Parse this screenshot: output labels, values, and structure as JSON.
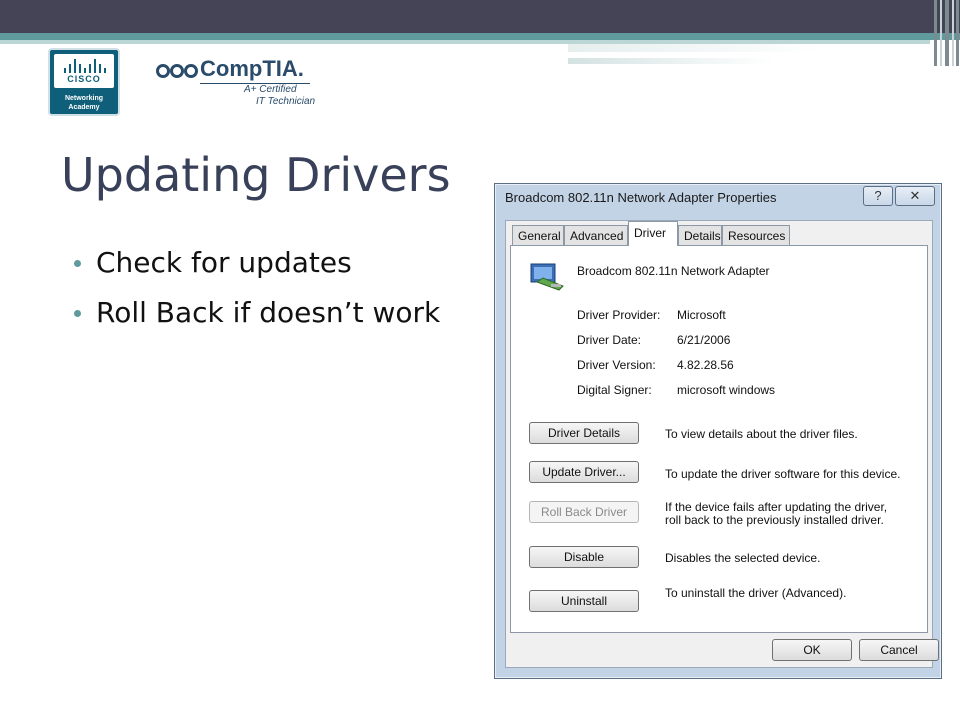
{
  "logos": {
    "cisco_word": "CISCO",
    "cisco_sub1": "Networking",
    "cisco_sub2": "Academy",
    "comptia_name": "CompTIA.",
    "comptia_cert": "A+ Certified",
    "comptia_tech": "IT Technician"
  },
  "slide": {
    "title": "Updating Drivers",
    "bullets": [
      "Check for updates",
      "Roll Back if doesn’t work"
    ]
  },
  "dialog": {
    "title": "Broadcom 802.11n Network Adapter Properties",
    "help_label": "?",
    "close_label": "✕",
    "tabs": [
      "General",
      "Advanced",
      "Driver",
      "Details",
      "Resources"
    ],
    "active_tab": "Driver",
    "device_name": "Broadcom 802.11n Network Adapter",
    "properties": [
      {
        "label": "Driver Provider:",
        "value": "Microsoft"
      },
      {
        "label": "Driver Date:",
        "value": "6/21/2006"
      },
      {
        "label": "Driver Version:",
        "value": "4.82.28.56"
      },
      {
        "label": "Digital Signer:",
        "value": "microsoft windows"
      }
    ],
    "actions": [
      {
        "label": "Driver Details",
        "desc": "To view details about the driver files.",
        "enabled": true
      },
      {
        "label": "Update Driver...",
        "desc": "To update the driver software for this device.",
        "enabled": true
      },
      {
        "label": "Roll Back Driver",
        "desc": "If the device fails after updating the driver, roll back to the previously installed driver.",
        "enabled": false
      },
      {
        "label": "Disable",
        "desc": "Disables the selected device.",
        "enabled": true
      },
      {
        "label": "Uninstall",
        "desc": "To uninstall the driver (Advanced).",
        "enabled": true
      }
    ],
    "ok_label": "OK",
    "cancel_label": "Cancel"
  },
  "colors": {
    "banner_dark": "#444456",
    "banner_teal": "#5f9a9c",
    "title_text": "#39405a",
    "bullet_dot": "#5f9a9c",
    "dialog_frame": "#c2d3e6"
  }
}
